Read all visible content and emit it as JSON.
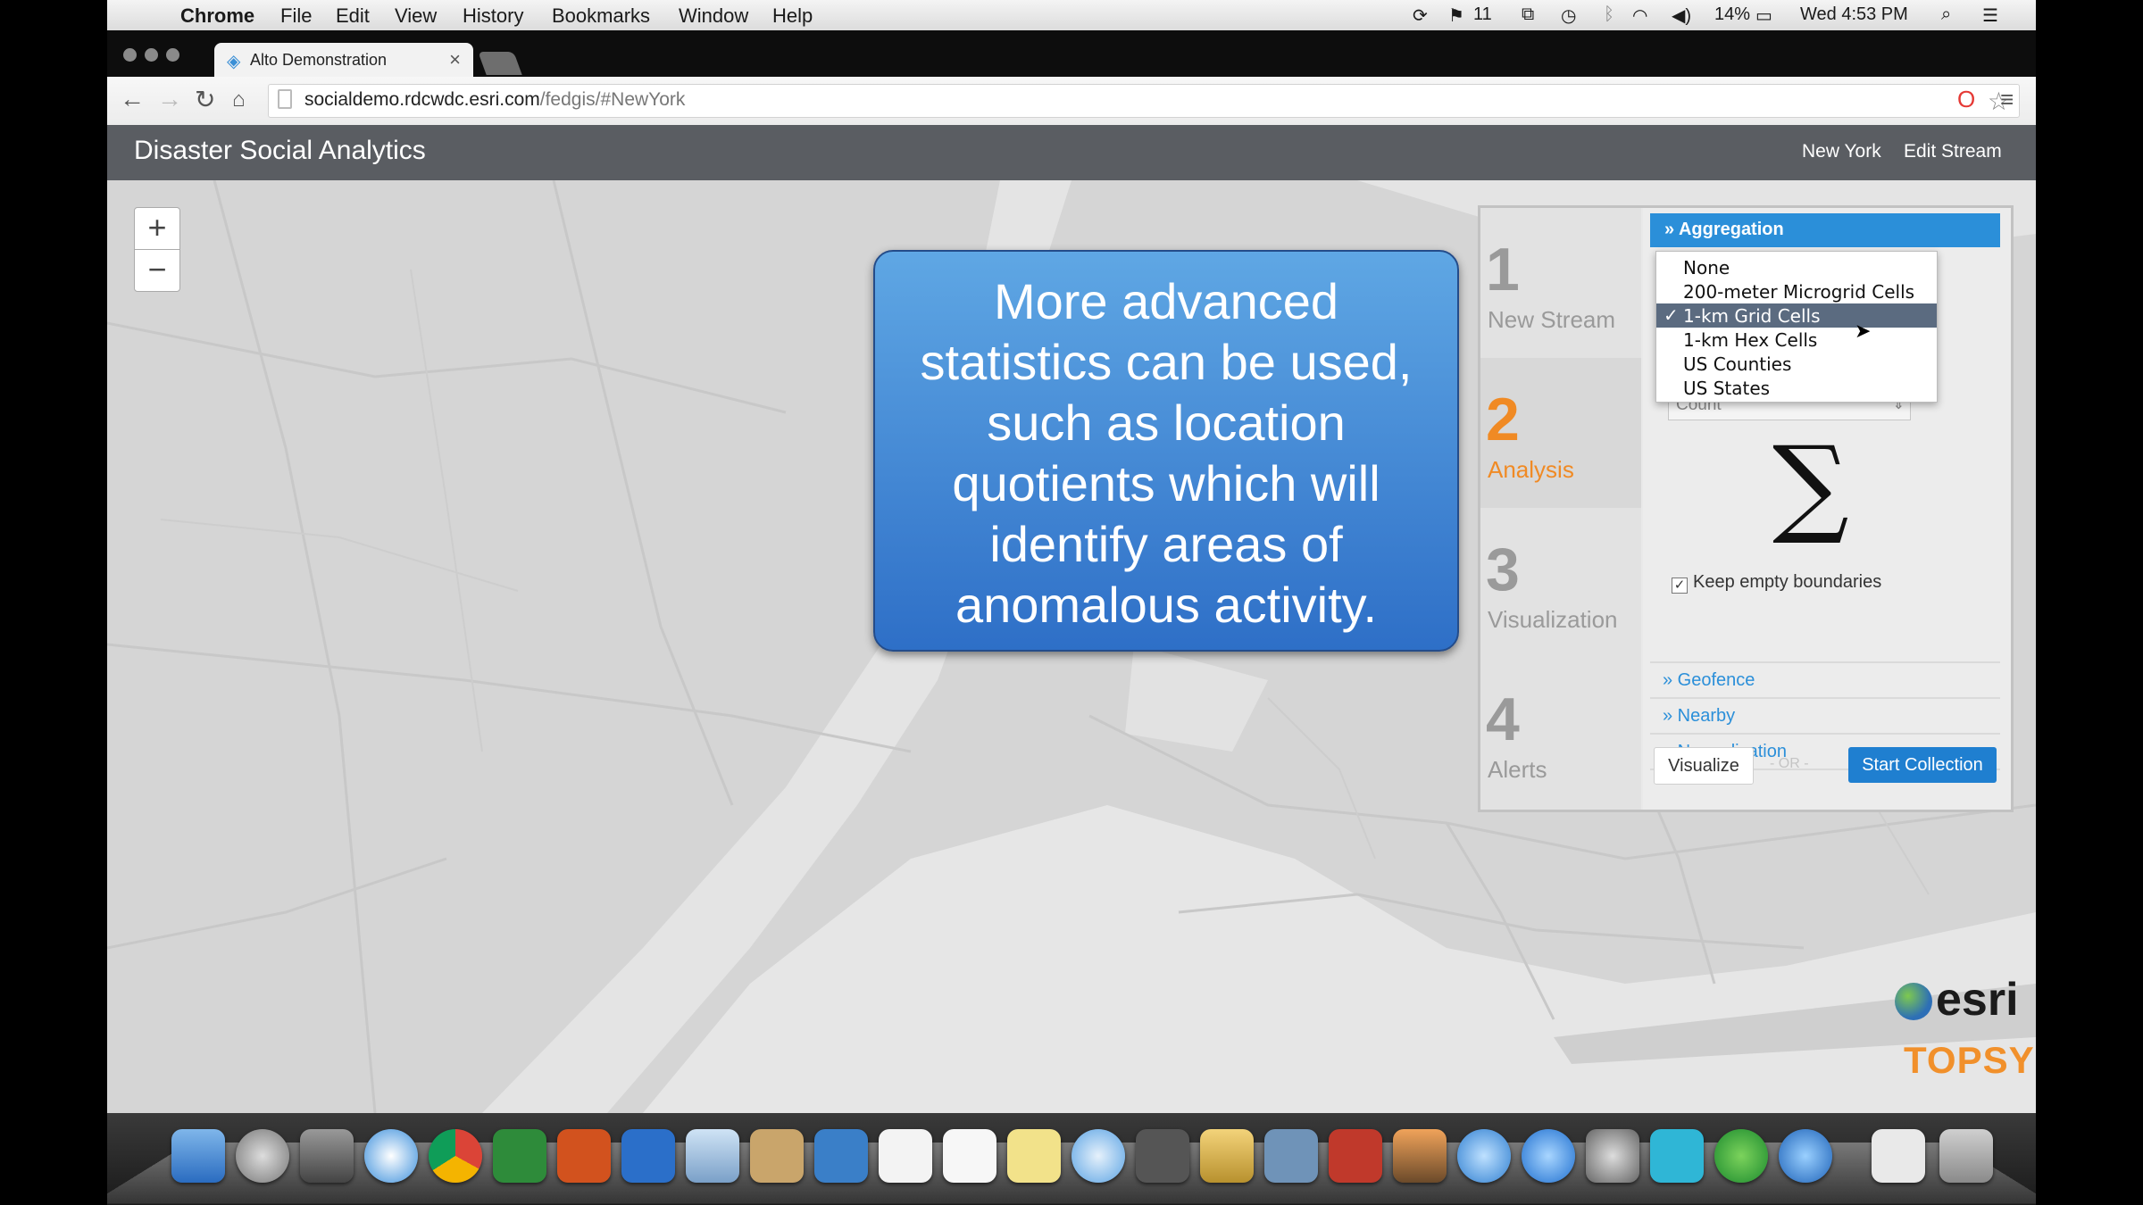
{
  "menubar": {
    "app": "Chrome",
    "items": [
      "File",
      "Edit",
      "View",
      "History",
      "Bookmarks",
      "Window",
      "Help"
    ],
    "status": {
      "notifications": "11",
      "battery": "14%",
      "clock": "Wed 4:53 PM"
    }
  },
  "browser": {
    "tab_title": "Alto Demonstration",
    "tab_close": "×",
    "url_host": "socialdemo.rdcwdc.esri.com",
    "url_path": "/fedgis/#NewYork"
  },
  "app": {
    "title": "Disaster Social Analytics",
    "nav": [
      "New York",
      "Edit Stream"
    ]
  },
  "map": {
    "zoom_in": "+",
    "zoom_out": "−",
    "callout": "More advanced statistics can be used, such as location quotients which will identify areas of anomalous activity."
  },
  "steps": [
    {
      "num": "1",
      "label": "New Stream"
    },
    {
      "num": "2",
      "label": "Analysis"
    },
    {
      "num": "3",
      "label": "Visualization"
    },
    {
      "num": "4",
      "label": "Alerts"
    }
  ],
  "analysis": {
    "aggregation_header": "» Aggregation",
    "dropdown_options": [
      "None",
      "200-meter Microgrid Cells",
      "1-km Grid Cells",
      "1-km Hex Cells",
      "US Counties",
      "US States"
    ],
    "selected_check": "✓",
    "statistic": "Count",
    "sigma": "∑",
    "keep_empty_label": "Keep empty boundaries",
    "keep_empty_check": "✓",
    "sections": [
      "» Geofence",
      "» Nearby",
      "» Normalization"
    ],
    "visualize_button": "Visualize",
    "or_text": "- OR -",
    "start_button": "Start Collection"
  },
  "logos": {
    "esri": "esri",
    "topsy": "TOPSY"
  },
  "colors": {
    "accent_blue": "#2b8fd9",
    "active_step": "#f08a24",
    "header_gray": "#5a5d62"
  }
}
